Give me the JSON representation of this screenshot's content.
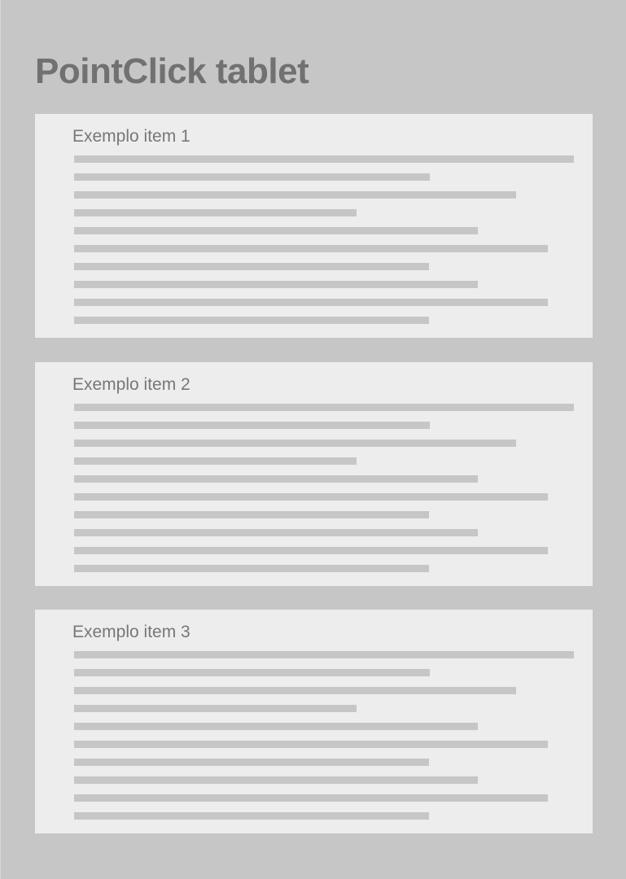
{
  "header": {
    "title": "PointClick tablet"
  },
  "items": [
    {
      "title": "Exemplo item 1"
    },
    {
      "title": "Exemplo item 2"
    },
    {
      "title": "Exemplo item 3"
    }
  ],
  "colors": {
    "background": "#c6c6c6",
    "card": "#ededed",
    "placeholder_line": "#c6c6c6",
    "title_text": "#717171",
    "card_title_text": "#777777"
  }
}
